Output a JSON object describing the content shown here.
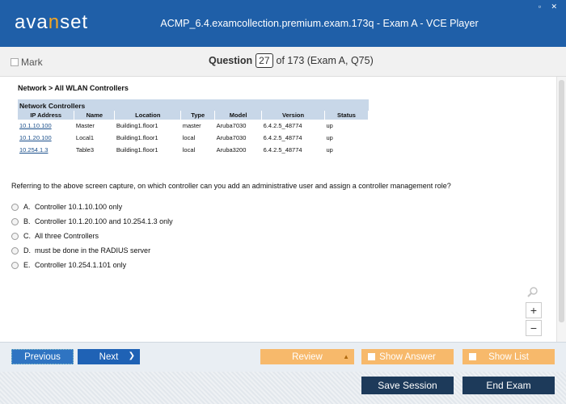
{
  "window": {
    "logo_main": "ava",
    "logo_accent": "n",
    "logo_end": "set",
    "title": "ACMP_6.4.examcollection.premium.exam.173q - Exam A - VCE Player",
    "controls": "▫ ✕"
  },
  "qbar": {
    "mark_label": "Mark",
    "question_label": "Question",
    "question_number": "27",
    "question_of": "of 173 (Exam A, Q75)"
  },
  "exhibit": {
    "breadcrumb": "Network > All WLAN Controllers",
    "caption": "Network Controllers",
    "columns": [
      "IP Address",
      "Name",
      "Location",
      "Type",
      "Model",
      "Version",
      "Status"
    ],
    "rows": [
      [
        "10.1.10.100",
        "Master",
        "Building1.floor1",
        "master",
        "Aruba7030",
        "6.4.2.5_48774",
        "up"
      ],
      [
        "10.1.20.100",
        "Local1",
        "Building1.floor1",
        "local",
        "Aruba7030",
        "6.4.2.5_48774",
        "up"
      ],
      [
        "10.254.1.3",
        "Table3",
        "Building1.floor1",
        "local",
        "Aruba3200",
        "6.4.2.5_48774",
        "up"
      ]
    ]
  },
  "question_text": "Referring to the above screen capture, on which controller can you add an administrative user and assign a controller management role?",
  "options": [
    {
      "letter": "A.",
      "text": "Controller 10.1.10.100 only"
    },
    {
      "letter": "B.",
      "text": "Controller 10.1.20.100 and 10.254.1.3 only"
    },
    {
      "letter": "C.",
      "text": "All three Controllers"
    },
    {
      "letter": "D.",
      "text": "must be done in the RADIUS server"
    },
    {
      "letter": "E.",
      "text": "Controller 10.254.1.101 only"
    }
  ],
  "zoom": {
    "plus": "+",
    "minus": "−"
  },
  "nav": {
    "previous": "Previous",
    "next": "Next",
    "review": "Review",
    "show_answer": "Show Answer",
    "show_list": "Show List",
    "save_session": "Save Session",
    "end_exam": "End Exam"
  },
  "colors": {
    "title_bar": "#1f5fa8",
    "nav_blue": "#1f62b5",
    "orange": "#f7b96b",
    "dark_button": "#1d3a5a"
  }
}
